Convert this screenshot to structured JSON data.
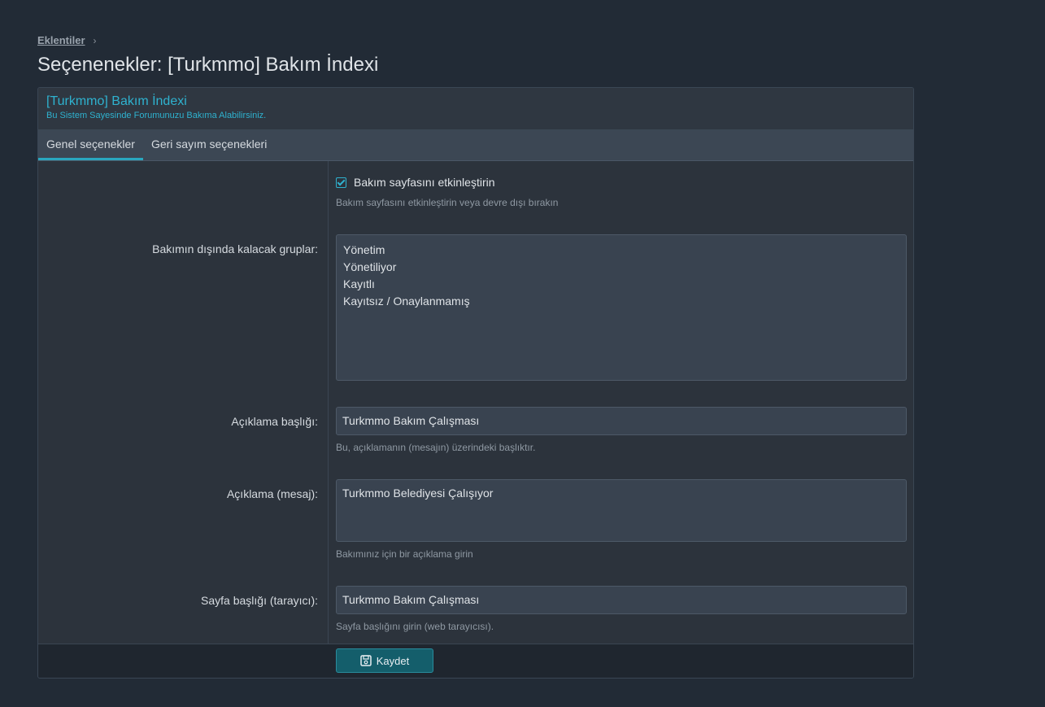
{
  "breadcrumb": {
    "link": "Eklentiler",
    "chevron": "›"
  },
  "page_title": "Seçenenekler: [Turkmmo] Bakım İndexi",
  "block": {
    "title": "[Turkmmo] Bakım İndexi",
    "description": "Bu Sistem Sayesinde Forumunuzu Bakıma Alabilirsiniz."
  },
  "tabs": [
    {
      "label": "Genel seçenekler",
      "active": true
    },
    {
      "label": "Geri sayım seçenekleri",
      "active": false
    }
  ],
  "options": {
    "enable": {
      "checked": true,
      "label": "Bakım sayfasını etkinleştirin",
      "hint": "Bakım sayfasını etkinleştirin veya devre dışı bırakın"
    },
    "groups": {
      "label": "Bakımın dışında kalacak gruplar:",
      "items": [
        "Yönetim",
        "Yönetiliyor",
        "Kayıtlı",
        "Kayıtsız / Onaylanmamış"
      ]
    },
    "desc_title": {
      "label": "Açıklama başlığı:",
      "value": "Turkmmo Bakım Çalışması",
      "hint": "Bu, açıklamanın (mesajın) üzerindeki başlıktır."
    },
    "desc_message": {
      "label": "Açıklama (mesaj):",
      "value": "Turkmmo Belediyesi Çalışıyor",
      "hint": "Bakımınız için bir açıklama girin"
    },
    "page_title": {
      "label": "Sayfa başlığı (tarayıcı):",
      "value": "Turkmmo Bakım Çalışması",
      "hint": "Sayfa başlığını girin (web tarayıcısı)."
    }
  },
  "footer": {
    "save_label": "Kaydet",
    "save_icon": "save-icon"
  },
  "colors": {
    "accent": "#2fb2cf",
    "button": "#145e6b",
    "background": "#222b36"
  }
}
